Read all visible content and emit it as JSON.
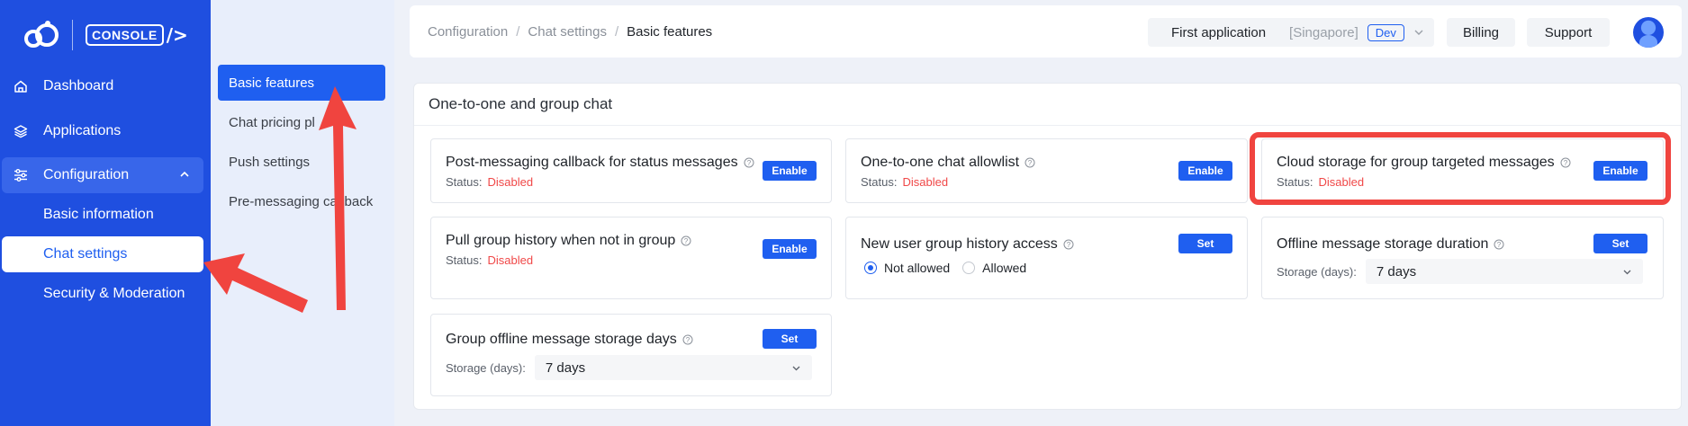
{
  "brand": {
    "console_label": "CONSOLE",
    "console_tail": "/>"
  },
  "sidebar": {
    "items": [
      {
        "label": "Dashboard",
        "icon": "home-icon"
      },
      {
        "label": "Applications",
        "icon": "layers-icon"
      },
      {
        "label": "Configuration",
        "icon": "sliders-icon",
        "expanded": true
      }
    ],
    "subitems": [
      {
        "label": "Basic information"
      },
      {
        "label": "Chat settings",
        "active": true
      },
      {
        "label": "Security & Moderation"
      }
    ]
  },
  "subnav": {
    "items": [
      {
        "label": "Basic features",
        "active": true
      },
      {
        "label": "Chat pricing pl"
      },
      {
        "label": "Push settings"
      },
      {
        "label": "Pre-messaging ca"
      }
    ],
    "items_tail": [
      "",
      "",
      "",
      "llback"
    ]
  },
  "header": {
    "breadcrumb": [
      "Configuration",
      "Chat settings",
      "Basic features"
    ],
    "breadcrumb_sep": "/",
    "app_name": "First application",
    "app_region": "[Singapore]",
    "app_env": "Dev",
    "billing": "Billing",
    "support": "Support"
  },
  "panel": {
    "title": "One-to-one and group chat",
    "cards": {
      "callback": {
        "title": "Post-messaging callback for status messages",
        "status_label": "Status:",
        "status_value": "Disabled",
        "button": "Enable"
      },
      "allowlist": {
        "title": "One-to-one chat allowlist",
        "status_label": "Status:",
        "status_value": "Disabled",
        "button": "Enable"
      },
      "cloud": {
        "title": "Cloud storage for group targeted messages",
        "status_label": "Status:",
        "status_value": "Disabled",
        "button": "Enable"
      },
      "pull_history": {
        "title": "Pull group history when not in group",
        "status_label": "Status:",
        "status_value": "Disabled",
        "button": "Enable"
      },
      "new_user": {
        "title": "New user group history access",
        "button": "Set",
        "options": [
          "Not allowed",
          "Allowed"
        ],
        "selected": "Not allowed"
      },
      "offline_duration": {
        "title": "Offline message storage duration",
        "button": "Set",
        "storage_label": "Storage (days):",
        "storage_value": "7 days"
      },
      "group_offline": {
        "title": "Group offline message storage days",
        "button": "Set",
        "storage_label": "Storage (days):",
        "storage_value": "7 days"
      }
    }
  },
  "colors": {
    "sidebar": "#1f4fe0",
    "accent": "#1f5ff0",
    "danger": "#f04848",
    "annotation": "#f0443f"
  }
}
